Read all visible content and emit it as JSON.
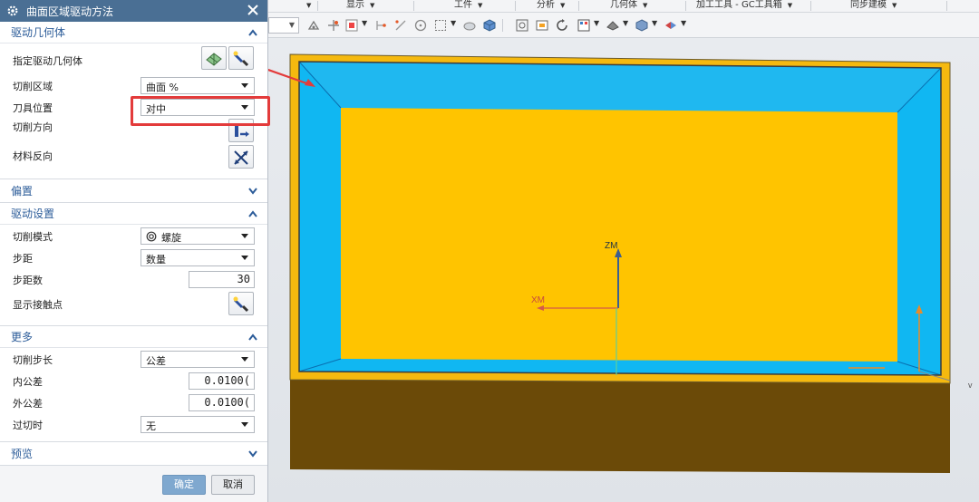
{
  "menubar": {
    "items": [
      {
        "label": "显示"
      },
      {
        "label": "工件"
      },
      {
        "label": "分析"
      },
      {
        "label": "几何体"
      },
      {
        "label": "加工工具 - GC工具箱"
      },
      {
        "label": "同步建模"
      }
    ]
  },
  "viewport": {
    "axis_zm": "ZM",
    "axis_xm": "XM",
    "colors": {
      "floor_face": "#ffc400",
      "wall_face": "#10b7f2",
      "rim": "#f5b90f",
      "base": "#6b4a08"
    }
  },
  "dialog": {
    "title": "曲面区域驱动方法",
    "sections": {
      "drive_geometry": {
        "title": "驱动几何体",
        "specify_label": "指定驱动几何体",
        "cut_area": {
          "label": "切削区域",
          "value": "曲面 %"
        },
        "tool_position": {
          "label": "刀具位置",
          "value": "对中"
        },
        "cut_direction_label": "切削方向",
        "material_reverse_label": "材料反向"
      },
      "offset": {
        "title": "偏置"
      },
      "drive_settings": {
        "title": "驱动设置",
        "cut_pattern": {
          "label": "切削模式",
          "value": "螺旋"
        },
        "stepover": {
          "label": "步距",
          "value": "数量"
        },
        "step_count": {
          "label": "步距数",
          "value": "30"
        },
        "show_contact_label": "显示接触点"
      },
      "more": {
        "title": "更多",
        "cut_step": {
          "label": "切削步长",
          "value": "公差"
        },
        "intol": {
          "label": "内公差",
          "value": "0.0100("
        },
        "outtol": {
          "label": "外公差",
          "value": "0.0100("
        },
        "overcut": {
          "label": "过切时",
          "value": "无"
        }
      },
      "preview": {
        "title": "预览"
      }
    },
    "buttons": {
      "ok": "确定",
      "cancel": "取消"
    }
  }
}
